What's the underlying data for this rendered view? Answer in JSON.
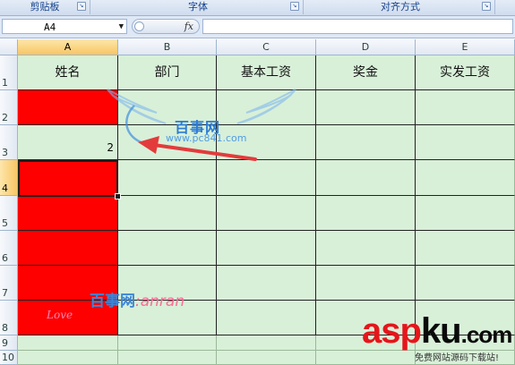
{
  "ribbon": {
    "groups": [
      {
        "label": "剪贴板"
      },
      {
        "label": "字体"
      },
      {
        "label": "对齐方式"
      }
    ]
  },
  "formula_bar": {
    "name_box": "A4",
    "fx_symbol": "fx",
    "formula": ""
  },
  "columns": [
    "A",
    "B",
    "C",
    "D",
    "E"
  ],
  "rows": [
    "1",
    "2",
    "3",
    "4",
    "5",
    "6",
    "7",
    "8",
    "9",
    "10"
  ],
  "table": {
    "headers": [
      "姓名",
      "部门",
      "基本工资",
      "奖金",
      "实发工资"
    ],
    "a3_value": "2"
  },
  "colors": {
    "cell_fill": "#d8f0d8",
    "highlight_fill": "#ff0000",
    "selected_header": "#f8c664"
  },
  "watermarks": {
    "top_brand": "百事网",
    "top_url": "www.pc841.com",
    "bottom_brand": "百事网",
    "bottom_tail": ":anran",
    "bottom_love": "Love",
    "logo_red": "asp",
    "logo_black": "ku",
    "logo_net": ".com",
    "logo_sub": "免费网站源码下载站!"
  }
}
